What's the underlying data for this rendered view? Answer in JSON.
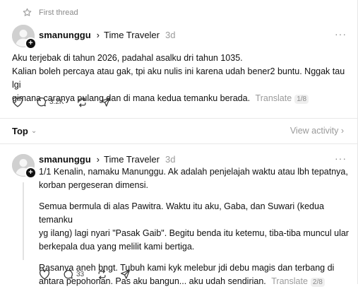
{
  "header": {
    "first_thread_label": "First thread"
  },
  "post": {
    "username": "smanunggu",
    "topic": "Time Traveler",
    "time": "3d",
    "lines": [
      "Aku terjebak di tahun 2026, padahal asalku dri tahun 1035.",
      "Kalian boleh percaya atau gak, tpi aku nulis ini karena udah bener2 buntu. Nggak tau lgi",
      "gimana caranya pulang dan di mana kedua temanku berada."
    ],
    "translate_label": "Translate",
    "counter": "1/8",
    "like_count": "",
    "reply_count": "3.2K",
    "repost_count": ""
  },
  "sort": {
    "label": "Top",
    "view_activity": "View activity"
  },
  "reply": {
    "username": "smanunggu",
    "topic": "Time Traveler",
    "time": "3d",
    "paragraph1": [
      "1/1 Kenalin, namaku Manunggu. Ak adalah penjelajah waktu atau lbh tepatnya,",
      "korban pergeseran dimensi."
    ],
    "paragraph2": [
      "Semua bermula di alas Pawitra. Waktu itu aku, Gaba, dan Suwari (kedua temanku",
      "yg ilang) lagi nyari \"Pasak Gaib\". Begitu benda itu ketemu, tiba-tiba muncul ular",
      "berkepala dua yang melilit kami bertiga."
    ],
    "paragraph3": [
      "Rasanya aneh bngt. Tubuh kami kyk melebur jdi debu magis dan terbang di",
      "antara pepohonan. Pas aku bangun... aku udah sendirian."
    ],
    "translate_label": "Translate",
    "counter": "2/8",
    "reply_count": "33"
  },
  "colors": {
    "text": "#101010",
    "muted": "#9a9a9a",
    "divider": "#e8e8e8"
  }
}
